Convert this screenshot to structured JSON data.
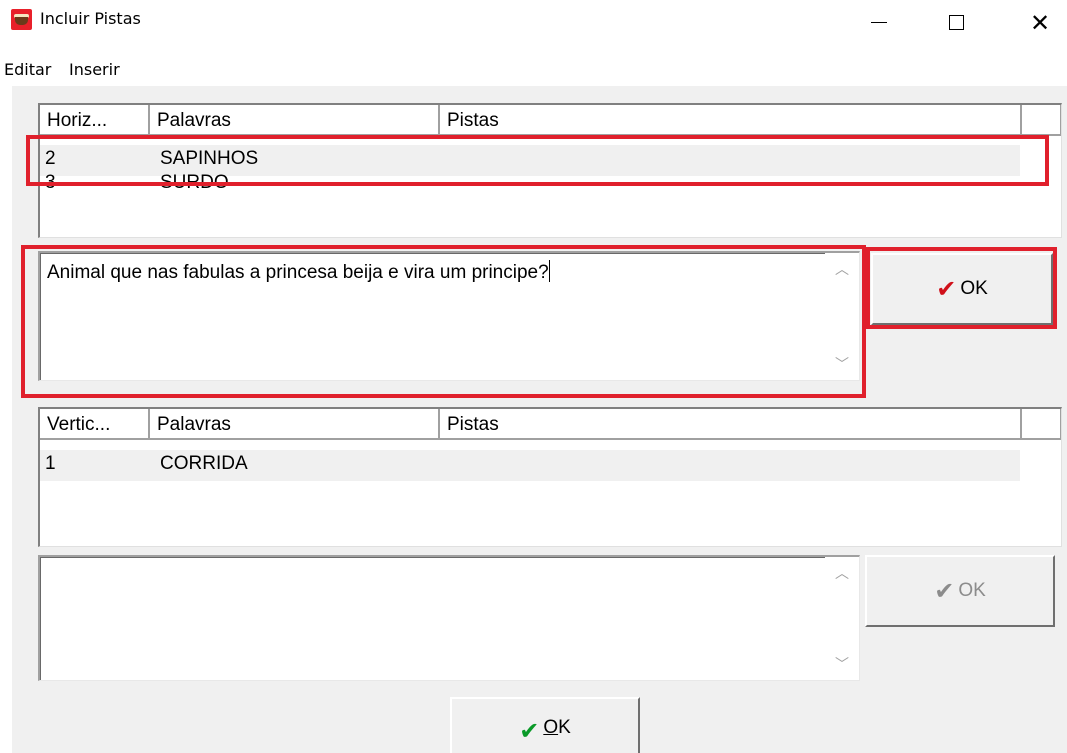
{
  "window": {
    "title": "Incluir Pistas",
    "controls": {
      "minimize": "—",
      "maximize": "☐",
      "close": "✕"
    }
  },
  "menu": [
    "Editar",
    "Inserir"
  ],
  "horizontal": {
    "columns": [
      "Horiz...",
      "Palavras",
      "Pistas"
    ],
    "rows": [
      {
        "num": "2",
        "word": "SAPINHOS",
        "clue": ""
      },
      {
        "num": "3",
        "word": "SURDO",
        "clue": ""
      }
    ],
    "selected_index": 0
  },
  "clue_editor_top": {
    "text": "Animal que nas fabulas a princesa beija e vira um principe?"
  },
  "ok_button_top": {
    "label": "OK",
    "icon": "check-red-icon",
    "enabled": true
  },
  "vertical": {
    "columns": [
      "Vertic...",
      "Palavras",
      "Pistas"
    ],
    "rows": [
      {
        "num": "1",
        "word": "CORRIDA",
        "clue": ""
      }
    ],
    "selected_index": 0
  },
  "clue_editor_bottom": {
    "text": ""
  },
  "ok_button_bottom": {
    "label": "OK",
    "icon": "check-gray-icon",
    "enabled": false
  },
  "ok_button_main": {
    "label_underlined": "O",
    "label_rest": "K",
    "icon": "check-green-icon"
  },
  "colors": {
    "highlight": "#e0202c",
    "check_red": "#d0101a",
    "check_green": "#0a9a28",
    "window_bg": "#f0f0f0"
  }
}
